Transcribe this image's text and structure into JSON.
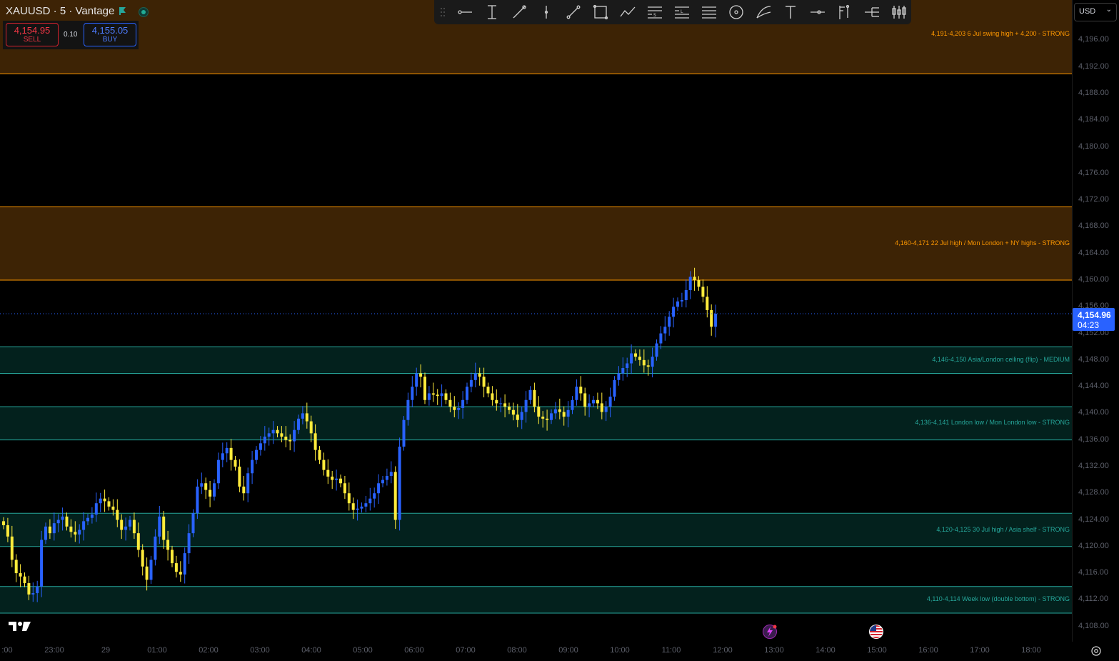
{
  "header": {
    "symbol_title": "XAUUSD · 5 · Vantage",
    "flag_icon": "flag-icon",
    "status_icon": "market-open-dot"
  },
  "trade": {
    "sell_price": "4,154.95",
    "sell_label": "SELL",
    "spread": "0.10",
    "buy_price": "4,155.05",
    "buy_label": "BUY"
  },
  "toolbar": {
    "tools": [
      "horizontal-ray-icon",
      "vertical-measure-icon",
      "trend-pen-icon",
      "vertical-line-icon",
      "trend-line-icon",
      "rectangle-icon",
      "path-icon",
      "fib-s-icon",
      "fib-l-icon",
      "parallel-lines-icon",
      "circle-icon",
      "brush-icon",
      "text-icon",
      "ray-icon",
      "flag-pole-icon",
      "fork-icon",
      "candles-icon"
    ]
  },
  "price_axis": {
    "currency": "USD",
    "ticks": [
      "4,196.00",
      "4,192.00",
      "4,188.00",
      "4,184.00",
      "4,180.00",
      "4,176.00",
      "4,172.00",
      "4,168.00",
      "4,164.00",
      "4,160.00",
      "4,156.00",
      "4,152.00",
      "4,148.00",
      "4,144.00",
      "4,140.00",
      "4,136.00",
      "4,132.00",
      "4,128.00",
      "4,124.00",
      "4,120.00",
      "4,116.00",
      "4,112.00",
      "4,108.00"
    ],
    "current_price": "4,154.96",
    "countdown": "04:23"
  },
  "time_axis": {
    "labels": [
      ":00",
      "23:00",
      "29",
      "01:00",
      "02:00",
      "03:00",
      "04:00",
      "05:00",
      "06:00",
      "07:00",
      "08:00",
      "09:00",
      "10:00",
      "11:00",
      "12:00",
      "13:00",
      "14:00",
      "15:00",
      "16:00",
      "17:00",
      "18:00"
    ]
  },
  "zones": [
    {
      "label": "4,191-4,203  6 Jul swing high + 4,200 - STRONG",
      "color": "#ff9800",
      "low": 4191,
      "high": 4203
    },
    {
      "label": "4,160-4,171  22 Jul high / Mon London + NY highs - STRONG",
      "color": "#ff9800",
      "low": 4160,
      "high": 4171
    },
    {
      "label": "4,146-4,150  Asia/London ceiling (flip) - MEDIUM",
      "color": "#26a69a",
      "low": 4146,
      "high": 4150
    },
    {
      "label": "4,136-4,141  London low / Mon London low - STRONG",
      "color": "#26a69a",
      "low": 4136,
      "high": 4141
    },
    {
      "label": "4,120-4,125  30 Jul high / Asia shelf - STRONG",
      "color": "#26a69a",
      "low": 4120,
      "high": 4125
    },
    {
      "label": "4,110-4,114  Week low (double bottom) - STRONG",
      "color": "#26a69a",
      "low": 4110,
      "high": 4114
    }
  ],
  "colors": {
    "up": "#2962ff",
    "down": "#ffeb3b",
    "background": "#000000",
    "price_line": "#2962ff"
  },
  "chart_data": {
    "type": "candlestick",
    "symbol": "XAUUSD",
    "interval": "5",
    "ylim": [
      4106,
      4200
    ],
    "close_series": [
      4123.2,
      4121.5,
      4118,
      4116,
      4115.5,
      4114.5,
      4112.8,
      4113,
      4114,
      4121,
      4123,
      4122,
      4123.5,
      4124,
      4124.5,
      4123,
      4122.2,
      4121.8,
      4122.5,
      4123.8,
      4124.3,
      4124.8,
      4126.5,
      4127.2,
      4126.8,
      4126,
      4125.5,
      4124,
      4122.5,
      4123,
      4124,
      4122,
      4119.5,
      4117,
      4115,
      4118,
      4121.5,
      4124.5,
      4121,
      4119.5,
      4117.5,
      4116.2,
      4115.8,
      4119,
      4122,
      4125,
      4129,
      4129.5,
      4128.5,
      4127.5,
      4129.5,
      4133,
      4134,
      4134.8,
      4133,
      4132,
      4129,
      4128,
      4131,
      4133,
      4134.5,
      4135.5,
      4136.5,
      4137,
      4137.5,
      4137,
      4136.5,
      4136,
      4135.8,
      4137.5,
      4139.2,
      4140,
      4138.8,
      4137,
      4134.5,
      4133,
      4131.5,
      4130.5,
      4130,
      4130.2,
      4129.5,
      4128,
      4126.5,
      4125.5,
      4125.7,
      4126,
      4126.5,
      4127.2,
      4128,
      4129.5,
      4130,
      4130.6,
      4131.2,
      4124,
      4135,
      4139,
      4142,
      4144,
      4146,
      4145.5,
      4142,
      4143,
      4142.8,
      4142.6,
      4143,
      4142,
      4141,
      4140.5,
      4140.8,
      4142,
      4144,
      4145,
      4146,
      4145.5,
      4144,
      4143,
      4142,
      4141.5,
      4141.5,
      4141,
      4140.5,
      4139.8,
      4139,
      4140.2,
      4142,
      4143.5,
      4141,
      4139.5,
      4139.2,
      4139,
      4140,
      4140.6,
      4140.2,
      4139.5,
      4140.5,
      4142,
      4144,
      4143,
      4141,
      4141.5,
      4142,
      4141.5,
      4140.2,
      4141,
      4142.5,
      4145,
      4146,
      4146.8,
      4147.5,
      4149,
      4148.5,
      4148,
      4147.2,
      4147,
      4148.5,
      4150.5,
      4152,
      4153,
      4154.5,
      4156,
      4156.8,
      4157,
      4158.5,
      4160.5,
      4160,
      4159,
      4157.5,
      4155.5,
      4153,
      4154.96
    ]
  }
}
